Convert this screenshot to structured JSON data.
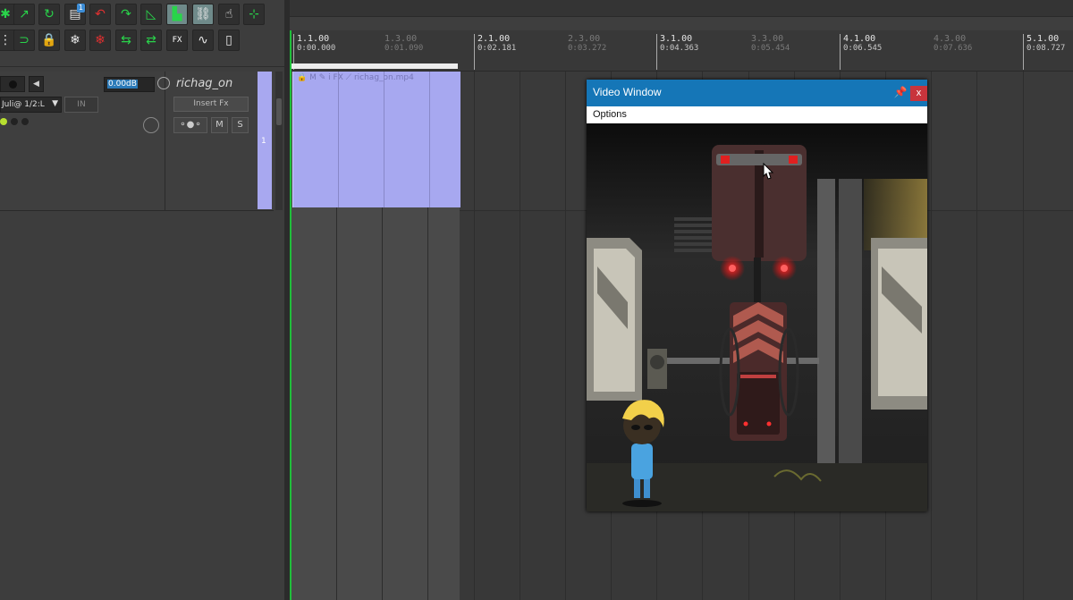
{
  "toolbar": {
    "icons": [
      "metronome-icon",
      "snap-icon",
      "ripple-icon",
      "undo-icon",
      "redo-icon",
      "grid-icon",
      "locking-icon",
      "mouse-edit-icon",
      "envelope-icon",
      "snap-toggle-icon",
      "freeze-icon",
      "unfreeze-icon",
      "render-icon",
      "fx-icon",
      "waveform-icon",
      "device-icon"
    ],
    "badge": "1",
    "fx_label": "FX"
  },
  "track": {
    "volume": "0.00dB",
    "name": "richag_on",
    "input": "Juli@ 1/2:L",
    "input_arrow": "▼",
    "in_label": "IN",
    "insert_fx": "Insert Fx",
    "mute": "M",
    "solo": "S",
    "number": "1"
  },
  "ruler": {
    "markers": [
      {
        "bar": "1.1.00",
        "time": "0:00.000",
        "major": true
      },
      {
        "bar": "1.3.00",
        "time": "0:01.090",
        "major": false
      },
      {
        "bar": "2.1.00",
        "time": "0:02.181",
        "major": true
      },
      {
        "bar": "2.3.00",
        "time": "0:03.272",
        "major": false
      },
      {
        "bar": "3.1.00",
        "time": "0:04.363",
        "major": true
      },
      {
        "bar": "3.3.00",
        "time": "0:05.454",
        "major": false
      },
      {
        "bar": "4.1.00",
        "time": "0:06.545",
        "major": true
      },
      {
        "bar": "4.3.00",
        "time": "0:07.636",
        "major": false
      },
      {
        "bar": "5.1.00",
        "time": "0:08.727",
        "major": true
      }
    ]
  },
  "media_item": {
    "name": "richag_on.mp4",
    "header_icons": [
      "lock-icon",
      "mute-item-icon",
      "notes-icon",
      "info-icon",
      "fx-item-icon",
      "envelope-item-icon"
    ],
    "header_labels": {
      "m": "M",
      "i": "i",
      "fx": "FX"
    }
  },
  "video_window": {
    "title": "Video Window",
    "pin": "🖈",
    "close": "x",
    "menu_options": "Options"
  },
  "colors": {
    "accent": "#1576b7",
    "close_red": "#c8343c",
    "item_blue": "#a7a8f0",
    "cursor_green": "#1fbf3a"
  }
}
